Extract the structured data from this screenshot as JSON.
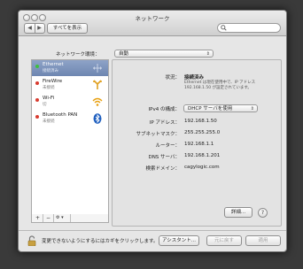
{
  "window": {
    "title": "ネットワーク",
    "nav_back": "◀",
    "nav_forward": "▶",
    "show_all": "すべてを表示",
    "search_placeholder": ""
  },
  "location": {
    "label": "ネットワーク環境：",
    "value": "自動"
  },
  "services": [
    {
      "name": "Ethernet",
      "status": "接続済み",
      "dot_color": "#3fbf3f",
      "icon": "ethernet-icon",
      "selected": true
    },
    {
      "name": "FireWire",
      "status": "未接続",
      "dot_color": "#d83b2f",
      "icon": "firewire-icon",
      "selected": false
    },
    {
      "name": "Wi-Fi",
      "status": "切",
      "dot_color": "#d83b2f",
      "icon": "wifi-icon",
      "selected": false
    },
    {
      "name": "Bluetooth PAN",
      "status": "未接続",
      "dot_color": "#d83b2f",
      "icon": "bluetooth-icon",
      "selected": false
    }
  ],
  "sidebar_buttons": {
    "add": "+",
    "remove": "−",
    "action": "⚙ ▾"
  },
  "details": {
    "status_label": "状況：",
    "status_value": "接続済み",
    "status_note": "Ethernet は現在使用中で、IP アドレス 192.168.1.50 が設定されています。",
    "config_label": "IPv4 の構成：",
    "config_value": "DHCP サーバを使用",
    "ip_label": "IP アドレス：",
    "ip_value": "192.168.1.50",
    "subnet_label": "サブネットマスク：",
    "subnet_value": "255.255.255.0",
    "router_label": "ルーター：",
    "router_value": "192.168.1.1",
    "dns_label": "DNS サーバ：",
    "dns_value": "192.168.1.201",
    "search_domain_label": "検索ドメイン：",
    "search_domain_value": "cagylogic.com",
    "advanced_button": "詳細...",
    "help_button": "?"
  },
  "footer": {
    "lock_text": "変更できないようにするにはカギをクリックします。",
    "assistant_button": "アシスタント...",
    "revert_button": "元に戻す",
    "apply_button": "適用"
  },
  "colors": {
    "selection": "#7a90b9",
    "connected": "#3fbf3f",
    "disconnected": "#d83b2f"
  }
}
